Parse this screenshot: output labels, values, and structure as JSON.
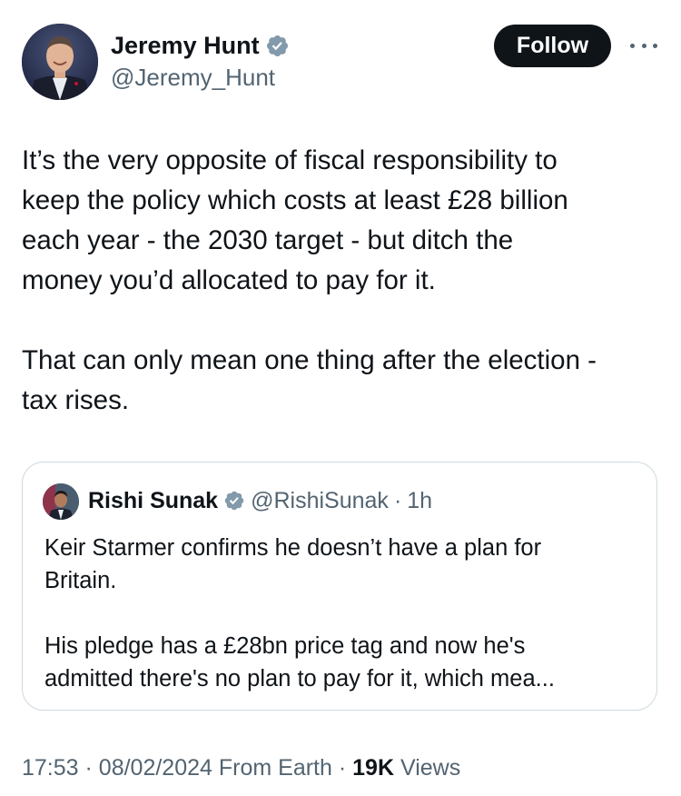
{
  "author": {
    "display_name": "Jeremy Hunt",
    "handle": "@Jeremy_Hunt",
    "verified": true,
    "verified_color": "#829aab"
  },
  "actions": {
    "follow_label": "Follow"
  },
  "tweet": {
    "lines_paragraph_1": [
      "It’s the very opposite of fiscal responsibility to",
      "keep the policy which costs at least £28 billion",
      "each year - the 2030 target - but ditch the",
      "money you’d allocated to pay for it."
    ],
    "lines_paragraph_2": [
      "That can only mean one thing after the election -",
      "tax rises."
    ]
  },
  "quoted_tweet": {
    "display_name": "Rishi Sunak",
    "handle": "@RishiSunak",
    "separator": "·",
    "time": "1h",
    "verified": true,
    "lines_paragraph_1": [
      "Keir Starmer confirms he doesn’t have a plan for",
      "Britain."
    ],
    "lines_paragraph_2": [
      "His pledge has a £28bn price tag and now he's",
      "admitted there's no plan to pay for it, which mea..."
    ]
  },
  "meta": {
    "time": "17:53",
    "separator_1": "·",
    "date": "08/02/2024",
    "source": "From Earth",
    "separator_2": "·",
    "views_count": "19K",
    "views_label": "Views"
  },
  "colors": {
    "text_primary": "#0f1419",
    "text_secondary": "#536471",
    "border": "#cfd9de",
    "follow_bg": "#0f1419",
    "follow_text": "#ffffff"
  },
  "icons": {
    "verified": "verified-badge-icon",
    "more": "more-horizontal-icon"
  }
}
